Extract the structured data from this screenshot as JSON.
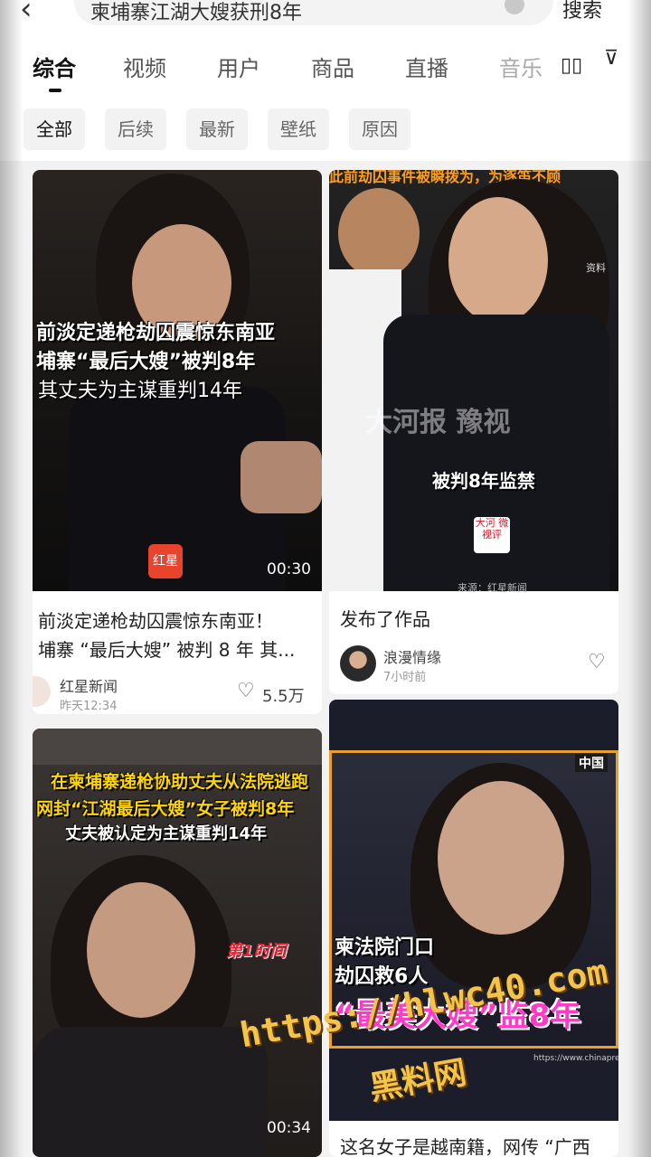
{
  "search": {
    "query": "柬埔寨江湖大嫂获刑8年",
    "button": "搜索"
  },
  "tabs": [
    "综合",
    "视频",
    "用户",
    "商品",
    "直播",
    "音乐"
  ],
  "filters": [
    "全部",
    "后续",
    "最新",
    "壁纸",
    "原因"
  ],
  "cards": {
    "c1": {
      "overlay": [
        "前淡定递枪劫囚震惊东南亚",
        "埔寨“最后大嫂”被判8年",
        "其丈夫为主谋重判14年"
      ],
      "badge": "红星",
      "duration": "00:30",
      "title": [
        "前淡定递枪劫囚震惊东南亚！",
        "埔寨 “最后大嫂” 被判 8 年 其..."
      ],
      "author": "红星新闻",
      "time": "昨天12:34",
      "likes": "5.5万"
    },
    "c2": {
      "banner": "此前劫囚事件被瞬拨为，为逐笛不顾",
      "source_tag": "资料",
      "logo_text": "大河报 豫视",
      "overlay": "被判8年监禁",
      "badge": "大河 微视评",
      "credit": "来源：红星新闻",
      "title": "发布了作品",
      "author": "浪漫情缘",
      "time": "7小时前"
    },
    "c3": {
      "overlay": [
        "在柬埔寨递枪协助丈夫从法院逃跑",
        "网封“江湖最后大嫂”女子被判8年",
        "丈夫被认定为主谋重判14年"
      ],
      "badge": "第1时间",
      "duration": "00:34"
    },
    "c4": {
      "corner": "中国",
      "overlay": [
        "柬法院门口",
        "劫囚救6人"
      ],
      "big": "“最美大嫂”监8年",
      "url": "https://www.chinapress.com",
      "title": "这名女子是越南籍，网传 “广西"
    }
  },
  "watermark": {
    "url": "https://hlwc40.com",
    "name": "黑料网"
  }
}
